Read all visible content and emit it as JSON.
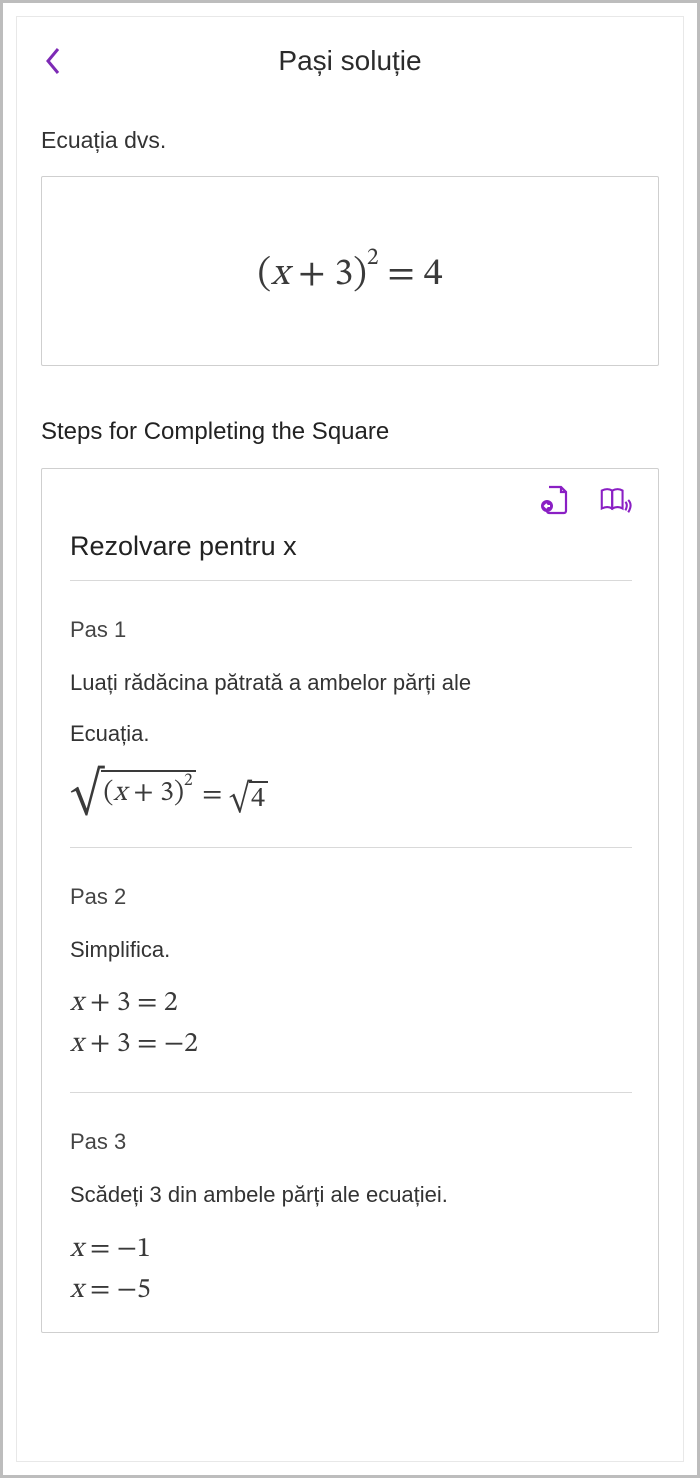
{
  "header": {
    "title": "Pași soluție"
  },
  "equation_section": {
    "label": "Ecuația dvs.",
    "eq_left_open": "(",
    "eq_var": "x",
    "eq_plus": " + 3)",
    "eq_exp": "2",
    "eq_eq": " = 4"
  },
  "steps_section": {
    "title": "Steps for Completing the Square",
    "solve_title": "Rezolvare pentru x"
  },
  "step1": {
    "label": "Pas 1",
    "line1": "Luați rădăcina pătrată a ambelor părți ale",
    "line2": "Ecuația.",
    "eq_inner_open": "(",
    "eq_inner_var": "x",
    "eq_inner_rest": " + 3)",
    "eq_inner_exp": "2",
    "eq_mid": " = ",
    "eq_rhs": "4"
  },
  "step2": {
    "label": "Pas 2",
    "text": "Simplifica.",
    "eq1_var": "x",
    "eq1_rest": " + 3 = 2",
    "eq2_var": "x",
    "eq2_rest": " + 3 = −2"
  },
  "step3": {
    "label": "Pas 3",
    "text": "Scădeți 3 din ambele părți ale ecuației.",
    "eq1_var": "x",
    "eq1_rest": " = −1",
    "eq2_var": "x",
    "eq2_rest": " = −5"
  },
  "icons": {
    "back": "chevron-left-icon",
    "copy_to_page": "insert-page-icon",
    "read_aloud": "read-aloud-icon"
  },
  "colors": {
    "accent": "#8a1fc4",
    "border": "#cfcfcf",
    "text": "#2b2b2b"
  }
}
